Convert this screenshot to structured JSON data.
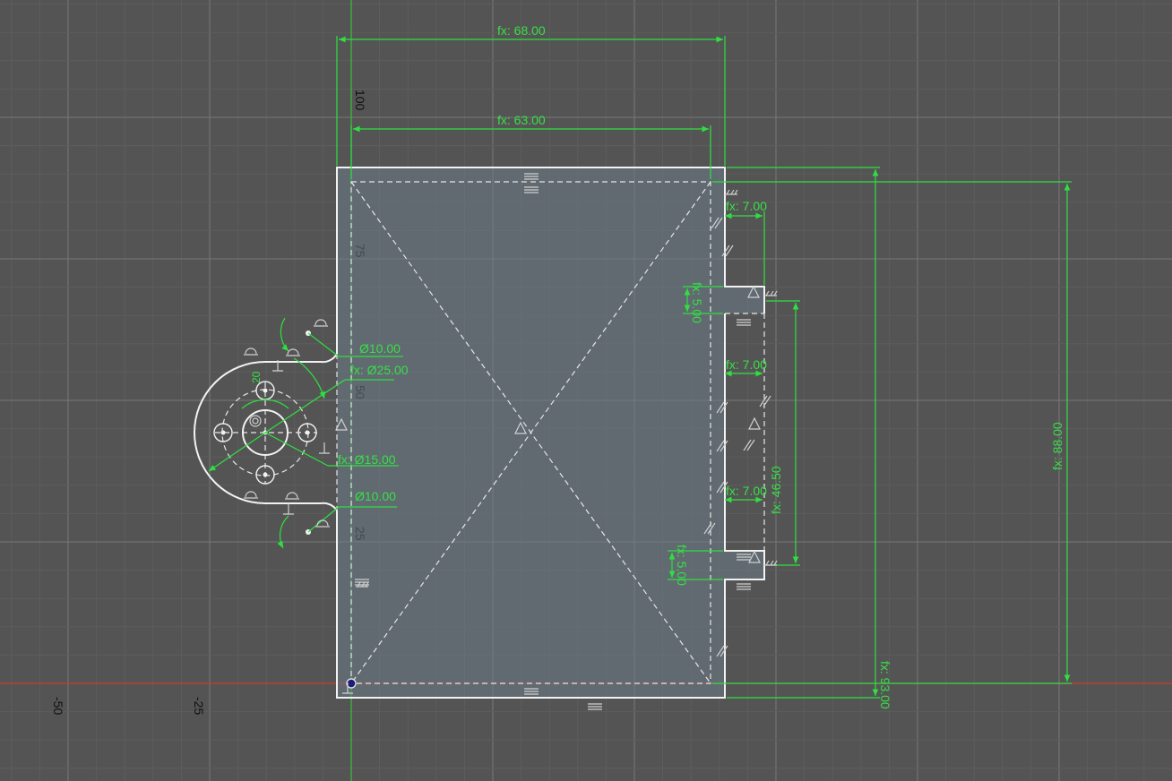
{
  "colors": {
    "background": "#545454",
    "grid_minor": "#5d5d5d",
    "grid_major": "#777777",
    "geometry": "#f2f2f2",
    "dimension": "#2ee040",
    "axis_x": "#d23a2a",
    "axis_y": "#38c238",
    "profile_fill": "#6a7b86"
  },
  "axis_labels": {
    "x_neg50": "-50",
    "x_neg25": "-25",
    "y_25": "25",
    "y_50": "50",
    "y_75": "75",
    "y_100": "100"
  },
  "dimensions": {
    "width_outer": "fx: 68.00",
    "width_inner": "fx: 63.00",
    "tab_width_top": "fx: 7.00",
    "tab_width_mid": "fx: 7.00",
    "tab_width_bottom": "fx: 7.00",
    "tab_height_top": "fx: 5.00",
    "tab_height_bottom": "fx: 5.00",
    "tab_span": "fx: 46.50",
    "height_inner": "fx: 88.00",
    "height_outer": "fx: 93.00",
    "fillet_top": "Ø10.00",
    "boss_dia": "fx: Ø25.00",
    "hole_dia": "fx: Ø15.00",
    "fillet_bottom": "Ø10.00",
    "small_20": "20"
  },
  "constraint_icons": [
    "horizontal-constraint-icon",
    "vertical-constraint-icon",
    "perpendicular-constraint-icon",
    "tangent-constraint-icon",
    "parallel-constraint-icon",
    "midpoint-constraint-icon",
    "coincident-constraint-icon",
    "concentric-constraint-icon",
    "fix-constraint-icon"
  ]
}
